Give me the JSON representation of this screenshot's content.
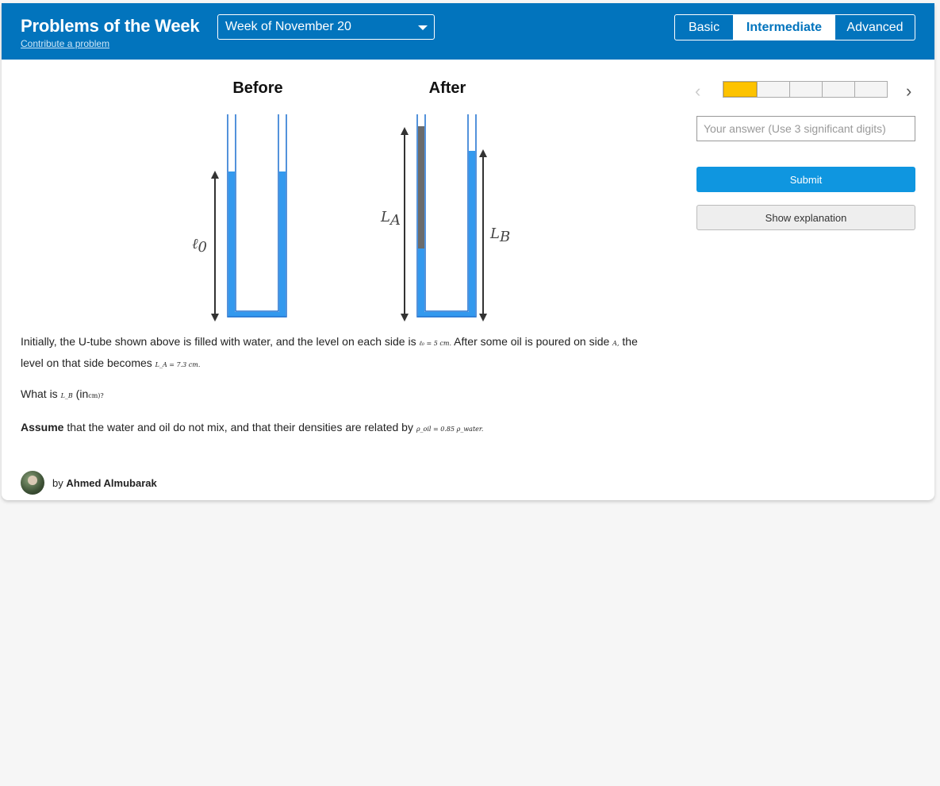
{
  "header": {
    "title": "Problems of the Week",
    "contribute_link": "Contribute a problem",
    "week_selected": "Week of November 20",
    "levels": [
      "Basic",
      "Intermediate",
      "Advanced"
    ],
    "active_level": "Intermediate"
  },
  "diagram": {
    "before_label": "Before",
    "after_label": "After",
    "l0_symbol": "ℓ",
    "l0_sub": "0",
    "la_symbol": "L",
    "la_sub": "A",
    "lb_symbol": "L",
    "lb_sub": "B",
    "colors": {
      "water": "#3399ee",
      "oil": "#6b6b6b",
      "arrow": "#333333"
    }
  },
  "problem": {
    "p1_a": "Initially, the U-tube shown above is filled with water, and the level on each side is",
    "p1_math1": "ℓ₀ = 5 cm.",
    "p1_b": "After some oil is poured on side",
    "p1_math2": "A,",
    "p1_c": "the",
    "p1_d": "level on that side becomes",
    "p1_math3": "L_A = 7.3 cm.",
    "q_a": "What is",
    "q_math": "L_B",
    "q_b": "(in",
    "q_unit": "cm)?",
    "assume_bold": "Assume",
    "assume_text": "that the water and oil do not mix, and that their densities are related by",
    "assume_math": "ρ_oil = 0.85 ρ_water."
  },
  "author": {
    "by": "by",
    "name": "Ahmed Almubarak"
  },
  "sidebar": {
    "progress_total": 5,
    "progress_done": 1,
    "answer_placeholder": "Your answer (Use 3 significant digits)",
    "submit_label": "Submit",
    "explanation_label": "Show explanation"
  }
}
